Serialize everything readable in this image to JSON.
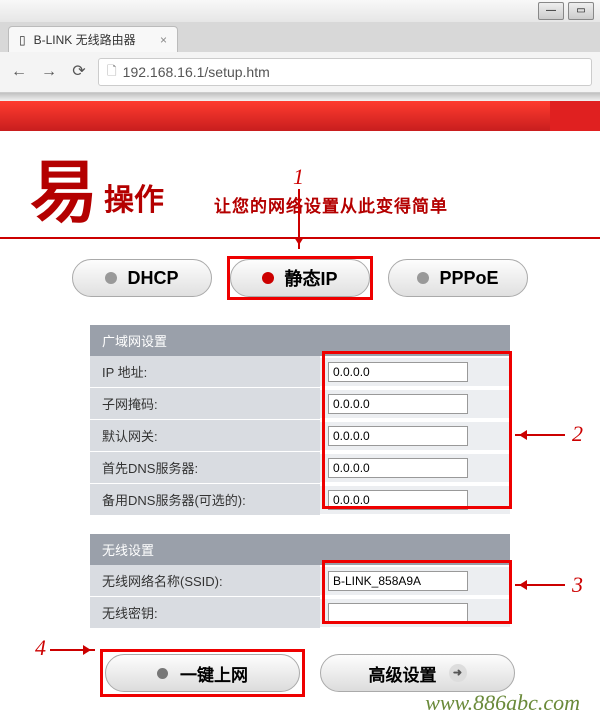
{
  "browser": {
    "tab_title": "B-LINK 无线路由器",
    "url": "192.168.16.1/setup.htm"
  },
  "header": {
    "logo_big": "易",
    "logo_small": "操作",
    "tagline": "让您的网络设置从此变得简单"
  },
  "tabs": {
    "dhcp": "DHCP",
    "static_ip": "静态IP",
    "pppoe": "PPPoE"
  },
  "wan": {
    "title": "广域网设置",
    "ip_label": "IP 地址:",
    "ip_value": "0.0.0.0",
    "mask_label": "子网掩码:",
    "mask_value": "0.0.0.0",
    "gw_label": "默认网关:",
    "gw_value": "0.0.0.0",
    "dns1_label": "首先DNS服务器:",
    "dns1_value": "0.0.0.0",
    "dns2_label": "备用DNS服务器(可选的):",
    "dns2_value": "0.0.0.0"
  },
  "wlan": {
    "title": "无线设置",
    "ssid_label": "无线网络名称(SSID):",
    "ssid_value": "B-LINK_858A9A",
    "key_label": "无线密钥:",
    "key_value": ""
  },
  "buttons": {
    "quick": "一键上网",
    "advanced": "高级设置"
  },
  "annotations": {
    "n1": "1",
    "n2": "2",
    "n3": "3",
    "n4": "4"
  },
  "watermark": "www.886abc.com"
}
